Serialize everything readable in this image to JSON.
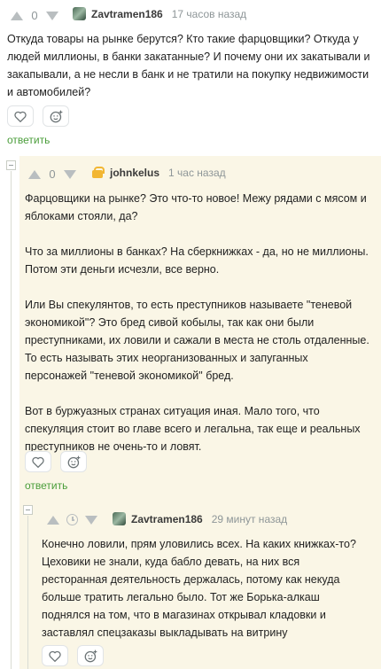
{
  "comments": [
    {
      "score": "0",
      "author": "Zavtramen186",
      "time": "17 часов назад",
      "text": "Откуда товары на рынке берутся? Кто такие фарцовщики? Откуда у людей миллионы, в банки закатанные? И почему они их закатывали и закапывали, а не несли в банк и не тратили на покупку недвижимости и автомобилей?",
      "reply_label": "ответить"
    },
    {
      "score": "0",
      "author": "johnkelus",
      "time": "1 час назад",
      "paragraphs": [
        "Фарцовщики на рынке? Это что-то новое! Межу рядами с мясом и яблоками стояли, да?",
        "Что за миллионы в банках? На сберкнижках - да, но не миллионы. Потом эти деньги исчезли, все верно.",
        "Или Вы спекулянтов, то есть преступников называете \"теневой экономикой\"? Это бред сивой кобылы, так как они были преступниками, их ловили и сажали в места не столь отдаленные. То есть называть этих неорганизованных и запуганных персонажей \"теневой экономикой\" бред.",
        "Вот в буржуазных странах ситуация иная. Мало того, что спекуляция стоит во главе всего и легальна, так еще и реальных преступников не очень-то и ловят."
      ],
      "reply_label": "ответить"
    },
    {
      "author": "Zavtramen186",
      "time": "29 минут назад",
      "text": "Конечно ловили, прям уловились всех. На каких книжках-то? Цеховики не знали, куда бабло девать, на них вся ресторанная деятельность держалась, потому как некуда больше тратить легально было. Тот же Борька-алкаш поднялся на том, что в магазинах открывал кладовки и заставлял спецзаказы выкладывать на витрину"
    }
  ],
  "colors": {
    "accent_green": "#4a9d3a",
    "highlight_bg": "#faf6e6"
  },
  "icons": [
    "arrow-up-icon",
    "arrow-down-icon",
    "clock-icon",
    "heart-icon",
    "smile-icon"
  ]
}
